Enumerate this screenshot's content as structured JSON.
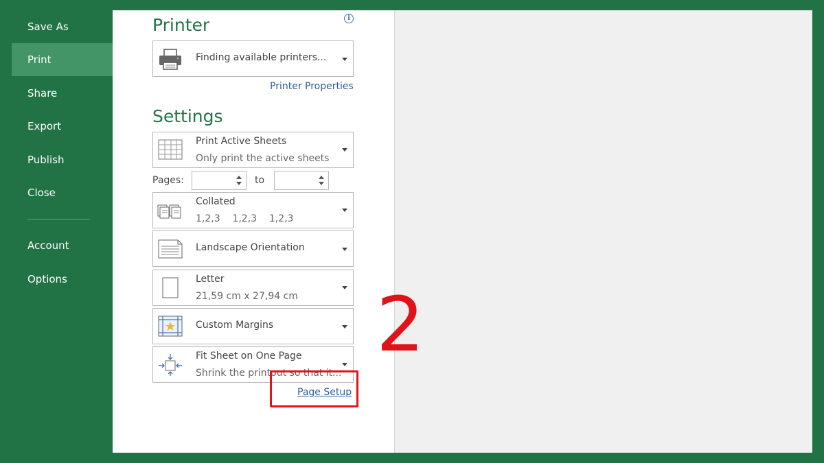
{
  "sidebar": {
    "items": [
      {
        "label": "Save As",
        "active": false
      },
      {
        "label": "Print",
        "active": true
      },
      {
        "label": "Share",
        "active": false
      },
      {
        "label": "Export",
        "active": false
      },
      {
        "label": "Publish",
        "active": false
      },
      {
        "label": "Close",
        "active": false
      }
    ],
    "bottom_items": [
      {
        "label": "Account"
      },
      {
        "label": "Options"
      }
    ]
  },
  "printer": {
    "title": "Printer",
    "selected": "Finding available printers...",
    "properties_link": "Printer Properties"
  },
  "settings": {
    "title": "Settings",
    "what": {
      "main": "Print Active Sheets",
      "sub": "Only print the active sheets"
    },
    "pages_label": "Pages:",
    "to_label": "to",
    "pages_from": "",
    "pages_to": "",
    "collation": {
      "main": "Collated",
      "sub": "1,2,3    1,2,3    1,2,3"
    },
    "orientation": {
      "main": "Landscape Orientation"
    },
    "paper": {
      "main": "Letter",
      "sub": "21,59 cm x 27,94 cm"
    },
    "margins": {
      "main": "Custom Margins"
    },
    "scaling": {
      "main": "Fit Sheet on One Page",
      "sub": "Shrink the printout so that it..."
    },
    "page_setup_link": "Page Setup"
  },
  "annotation": {
    "step_number": "2",
    "color": "#e0131b"
  },
  "colors": {
    "brand_green": "#217346",
    "active_nav": "#439467",
    "link": "#2e5c9a"
  }
}
